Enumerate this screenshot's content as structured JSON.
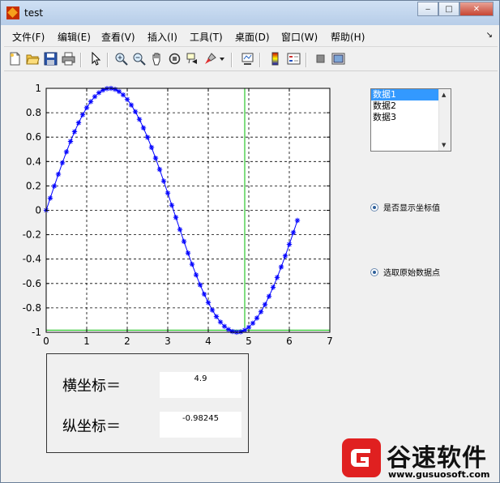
{
  "window": {
    "title": "test",
    "minimize_glyph": "‒",
    "maximize_glyph": "□",
    "close_glyph": "✕"
  },
  "menu": {
    "items": [
      "文件(F)",
      "编辑(E)",
      "查看(V)",
      "插入(I)",
      "工具(T)",
      "桌面(D)",
      "窗口(W)",
      "帮助(H)"
    ],
    "overflow_glyph": "↘"
  },
  "toolbar": {
    "icons": [
      "new-file-icon",
      "open-folder-icon",
      "save-icon",
      "print-icon",
      "pointer-icon",
      "zoom-in-icon",
      "zoom-out-icon",
      "pan-hand-icon",
      "rotate-3d-icon",
      "data-cursor-icon",
      "brush-icon",
      "brush-dropdown-icon",
      "link-plot-icon",
      "colorbar-icon",
      "legend-icon",
      "hide-plot-tools-icon",
      "show-plot-tools-icon"
    ]
  },
  "chart_data": {
    "type": "line",
    "series": [
      {
        "marker": "*",
        "color": "#0000ff",
        "x": [
          0,
          0.1,
          0.2,
          0.3,
          0.4,
          0.5,
          0.6,
          0.7,
          0.8,
          0.9,
          1.0,
          1.1,
          1.2,
          1.3,
          1.4,
          1.5,
          1.6,
          1.7,
          1.8,
          1.9,
          2.0,
          2.1,
          2.2,
          2.3,
          2.4,
          2.5,
          2.6,
          2.7,
          2.8,
          2.9,
          3.0,
          3.1,
          3.2,
          3.3,
          3.4,
          3.5,
          3.6,
          3.7,
          3.8,
          3.9,
          4.0,
          4.1,
          4.2,
          4.3,
          4.4,
          4.5,
          4.6,
          4.7,
          4.8,
          4.9,
          5.0,
          5.1,
          5.2,
          5.3,
          5.4,
          5.5,
          5.6,
          5.7,
          5.8,
          5.9,
          6.0,
          6.1,
          6.2
        ],
        "y": [
          0,
          0.0998,
          0.1987,
          0.2955,
          0.3894,
          0.4794,
          0.5646,
          0.6442,
          0.7174,
          0.7833,
          0.8415,
          0.8912,
          0.932,
          0.9636,
          0.9854,
          0.9975,
          0.9996,
          0.9917,
          0.9738,
          0.9463,
          0.9093,
          0.8632,
          0.8085,
          0.7457,
          0.6755,
          0.5985,
          0.5155,
          0.4274,
          0.335,
          0.2392,
          0.1411,
          0.0416,
          -0.0584,
          -0.1577,
          -0.2555,
          -0.3508,
          -0.4425,
          -0.5298,
          -0.6119,
          -0.6878,
          -0.7568,
          -0.8183,
          -0.8716,
          -0.9162,
          -0.9516,
          -0.9775,
          -0.9937,
          -0.9999,
          -0.9962,
          -0.9825,
          -0.9589,
          -0.9258,
          -0.8835,
          -0.8323,
          -0.7728,
          -0.7055,
          -0.6313,
          -0.5507,
          -0.4646,
          -0.3739,
          -0.2794,
          -0.1822,
          -0.0831
        ]
      }
    ],
    "crosshair": {
      "x": 4.9,
      "y": -0.98245,
      "color": "#00bb00"
    },
    "xlim": [
      0,
      7
    ],
    "ylim": [
      -1,
      1
    ],
    "xticks": [
      0,
      1,
      2,
      3,
      4,
      5,
      6,
      7
    ],
    "yticks": [
      -1,
      -0.8,
      -0.6,
      -0.4,
      -0.2,
      0,
      0.2,
      0.4,
      0.6,
      0.8,
      1
    ],
    "grid": true,
    "grid_style": "dashed"
  },
  "listbox": {
    "options": [
      "数据1",
      "数据2",
      "数据3"
    ],
    "selected_index": 0,
    "scroll_up_glyph": "▲",
    "scroll_down_glyph": "▼"
  },
  "radios": [
    {
      "label": "是否显示坐标值",
      "checked": true
    },
    {
      "label": "选取原始数据点",
      "checked": true
    }
  ],
  "coords": {
    "x_label": "横坐标＝",
    "x_value": "4.9",
    "y_label": "纵坐标＝",
    "y_value": "-0.98245"
  },
  "watermark": {
    "name": "谷速软件",
    "url": "www.gusuosoft.com",
    "brand_color": "#e02020"
  }
}
